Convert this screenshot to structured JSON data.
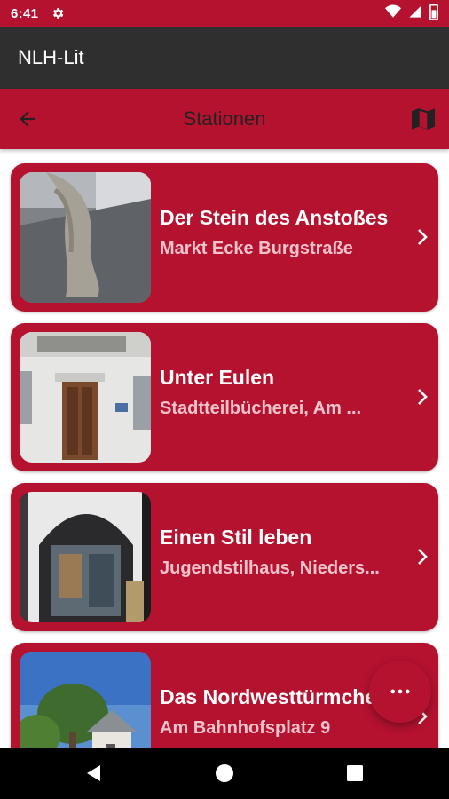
{
  "status": {
    "time": "6:41"
  },
  "app": {
    "title": "NLH-Lit"
  },
  "toolbar": {
    "heading": "Stationen"
  },
  "stations": [
    {
      "name": "Der Stein des Anstoßes",
      "address": "Markt Ecke Burgstraße"
    },
    {
      "name": "Unter Eulen",
      "address": "Stadtteilbücherei, Am ..."
    },
    {
      "name": "Einen Stil leben",
      "address": "Jugendstilhaus, Nieders..."
    },
    {
      "name": "Das Nordwesttürmchen",
      "address": "Am Bahnhofsplatz 9"
    }
  ],
  "colors": {
    "accent": "#b5122f",
    "appbar": "#2f2f2f",
    "subtitle": "#f3c3cc"
  },
  "icons": [
    "settings-icon",
    "wifi-icon",
    "signal-icon",
    "battery-icon",
    "back-arrow-icon",
    "map-icon",
    "chevron-right-icon",
    "more-horizontal-icon",
    "nav-back-icon",
    "nav-home-icon",
    "nav-recents-icon"
  ]
}
